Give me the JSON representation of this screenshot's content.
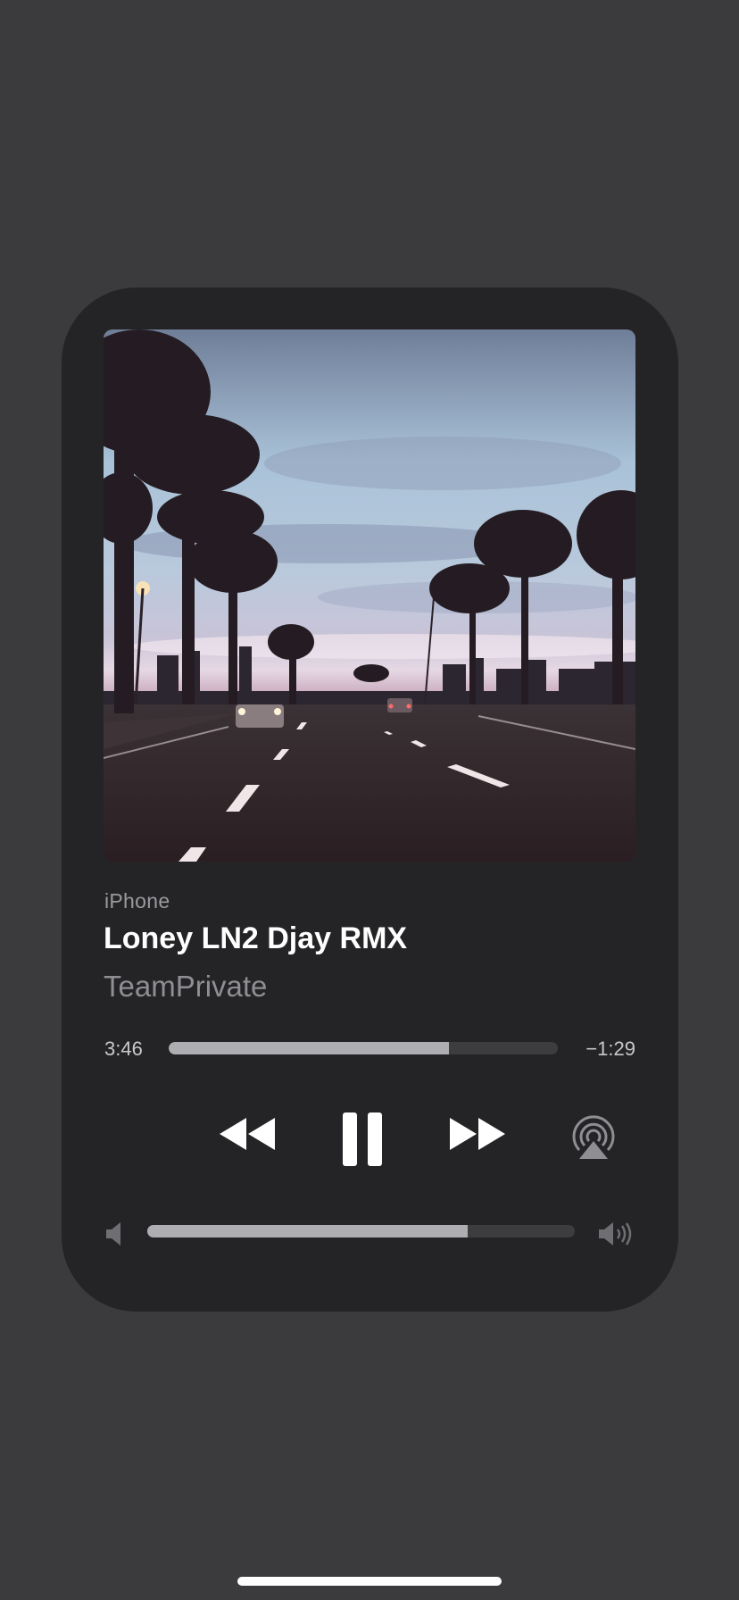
{
  "now_playing": {
    "source": "iPhone",
    "title": "Loney LN2 Djay RMX",
    "artist": "TeamPrivate",
    "elapsed": "3:46",
    "remaining": "−1:29",
    "progress_fraction": 0.72,
    "volume_fraction": 0.75
  },
  "icons": {
    "rewind": "rewind-icon",
    "pause": "pause-icon",
    "forward": "fast-forward-icon",
    "airplay": "airplay-icon",
    "volume_low": "speaker-low-icon",
    "volume_high": "speaker-high-icon"
  },
  "colors": {
    "background": "#3b3b3e",
    "card": "#242426",
    "accent_fill": "#aeaeb2",
    "track": "#3d3d40"
  }
}
